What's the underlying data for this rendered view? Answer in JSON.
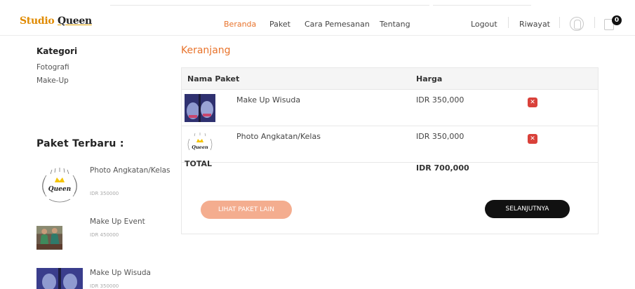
{
  "brand": {
    "prefix": "Studio",
    "strong": "Queen"
  },
  "nav": {
    "items": [
      {
        "label": "Beranda",
        "active": true
      },
      {
        "label": "Paket",
        "active": false
      },
      {
        "label": "Cara Pemesanan",
        "active": false
      },
      {
        "label": "Tentang",
        "active": false
      }
    ],
    "logout": "Logout",
    "history": "Riwayat",
    "bag_count": "0"
  },
  "sidebar": {
    "category_title": "Kategori",
    "categories": [
      "Fotografi",
      "Make-Up"
    ],
    "latest_title": "Paket Terbaru :",
    "latest": [
      {
        "name": "Photo Angkatan/Kelas",
        "price": "IDR 350000",
        "icon": "queen-crown-logo"
      },
      {
        "name": "Make Up Event",
        "price": "IDR 450000",
        "icon": "two-women-photo"
      },
      {
        "name": "Make Up Wisuda",
        "price": "IDR 350000",
        "icon": "makeup-faces-photo"
      }
    ]
  },
  "cart": {
    "title": "Keranjang",
    "columns": [
      "Nama Paket",
      "Harga"
    ],
    "rows": [
      {
        "name": "Make Up Wisuda",
        "price": "IDR 350,000",
        "icon": "makeup-faces-photo"
      },
      {
        "name": "Photo Angkatan/Kelas",
        "price": "IDR 350,000",
        "icon": "queen-crown-logo"
      }
    ],
    "total_label": "TOTAL",
    "total_value": "IDR 700,000",
    "more_button": "LIHAT PAKET LAIN",
    "next_button": "SELANJUTNYA"
  },
  "colors": {
    "accent": "#e8732b",
    "delete": "#d9413a",
    "more_button": "#f4ad8f",
    "next_button": "#111111"
  }
}
